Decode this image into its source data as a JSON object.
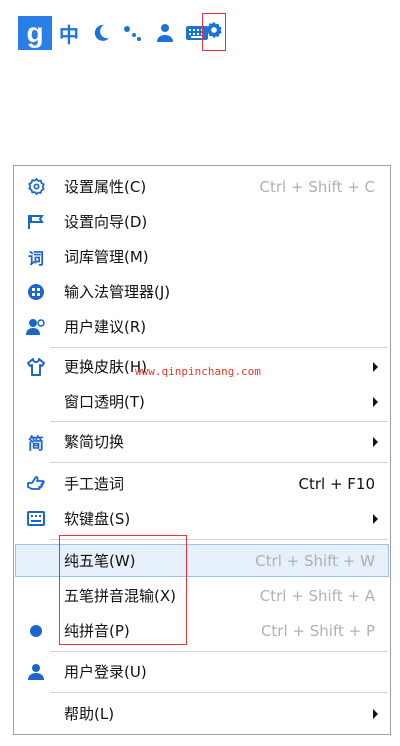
{
  "toolbar": {
    "logo_letter": "g",
    "mode_label": "中",
    "buttons": [
      "logo-icon",
      "chinese-mode-label",
      "moon-icon",
      "punctuation-icon",
      "user-icon",
      "keyboard-icon",
      "gear-icon"
    ]
  },
  "menu": {
    "items": [
      {
        "label": "设置属性(C)",
        "shortcut": "Ctrl + Shift + C",
        "icon": "gear-icon"
      },
      {
        "label": "设置向导(D)",
        "shortcut": "",
        "icon": "flag-icon"
      },
      {
        "label": "词库管理(M)",
        "shortcut": "",
        "icon": "dictionary-icon"
      },
      {
        "label": "输入法管理器(J)",
        "shortcut": "",
        "icon": "input-manager-icon"
      },
      {
        "label": "用户建议(R)",
        "shortcut": "",
        "icon": "user-feedback-icon"
      },
      {
        "label": "更换皮肤(H)",
        "shortcut": "",
        "icon": "shirt-icon",
        "submenu": true
      },
      {
        "label": "窗口透明(T)",
        "shortcut": "",
        "icon": "",
        "submenu": true
      },
      {
        "label": "繁简切换",
        "shortcut": "",
        "icon": "traditional-simplified-icon",
        "submenu": true
      },
      {
        "label": "手工造词",
        "shortcut": "Ctrl + F10",
        "icon": "hand-icon"
      },
      {
        "label": "软键盘(S)",
        "shortcut": "",
        "icon": "keyboard-icon",
        "submenu": true
      },
      {
        "label": "纯五笔(W)",
        "shortcut": "Ctrl + Shift + W",
        "icon": ""
      },
      {
        "label": "五笔拼音混输(X)",
        "shortcut": "Ctrl + Shift + A",
        "icon": ""
      },
      {
        "label": "纯拼音(P)",
        "shortcut": "Ctrl + Shift + P",
        "icon": "radio-dot-icon"
      },
      {
        "label": "用户登录(U)",
        "shortcut": "",
        "icon": "user-icon"
      },
      {
        "label": "帮助(L)",
        "shortcut": "",
        "icon": "",
        "submenu": true
      }
    ]
  },
  "watermark": "www.qinpinchang.com",
  "colors": {
    "accent": "#1a66cc",
    "highlight_bg": "#e6f0fb",
    "annotation_red": "#e33333",
    "shortcut_gray": "#b0b0b0"
  }
}
